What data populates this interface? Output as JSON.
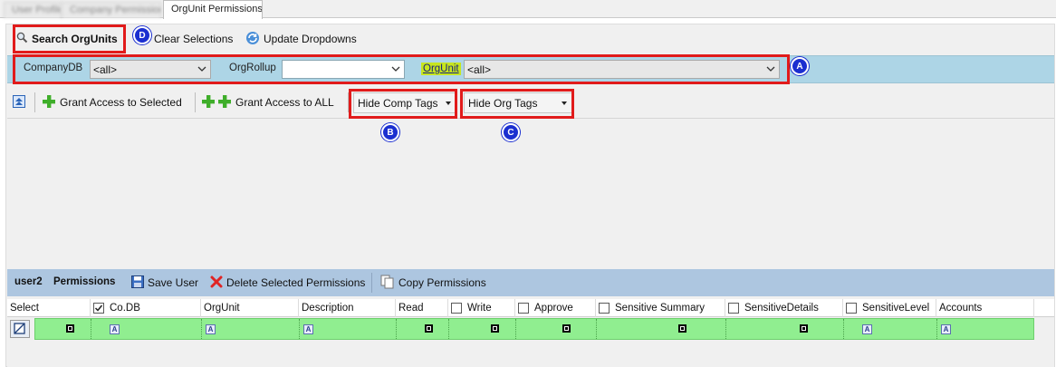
{
  "tabs": [
    {
      "label": "User Profile"
    },
    {
      "label": "Company Permissions"
    },
    {
      "label": "OrgUnit Permissions"
    }
  ],
  "toolbar": {
    "search_label": "Search OrgUnits",
    "clear_label": "Clear Selections",
    "update_label": "Update Dropdowns"
  },
  "filters": {
    "companydb_label": "CompanyDB",
    "companydb_value": "<all>",
    "orgrollup_label": "OrgRollup",
    "orgrollup_value": "",
    "orgunit_label": "OrgUnit",
    "orgunit_value": "<all>"
  },
  "actions": {
    "grant_selected_label": "Grant Access to Selected",
    "grant_all_label": "Grant Access to ALL",
    "hide_comp_tags": "Hide Comp Tags",
    "hide_org_tags": "Hide Org Tags"
  },
  "permissions": {
    "user": "user2",
    "title": "Permissions",
    "save_label": "Save User",
    "delete_label": "Delete Selected Permissions",
    "copy_label": "Copy Permissions"
  },
  "grid": {
    "columns": {
      "select": "Select",
      "codb": "Co.DB",
      "orgunit": "OrgUnit",
      "description": "Description",
      "read": "Read",
      "write": "Write",
      "approve": "Approve",
      "sensitive_summary": "Sensitive Summary",
      "sensitive_details": "SensitiveDetails",
      "sensitive_level": "SensitiveLevel",
      "accounts": "Accounts"
    }
  },
  "annotations": {
    "a": "A",
    "b": "B",
    "c": "C",
    "d": "D"
  },
  "colors": {
    "filter_bar": "#add5e6",
    "permissions_bar": "#adc6e0",
    "grid_row": "#90ee90",
    "annotation_red": "#e11b1b",
    "annotation_badge": "#1b2fd0",
    "orgunit_highlight": "#c7e61e"
  }
}
